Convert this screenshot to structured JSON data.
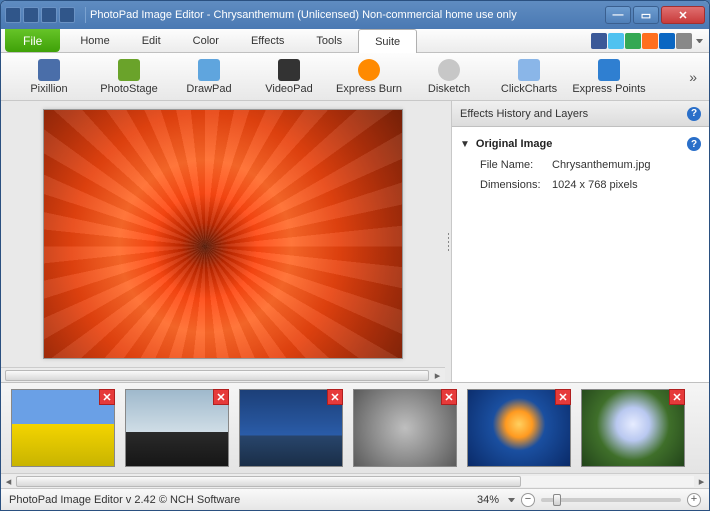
{
  "title": "PhotoPad Image Editor - Chrysanthemum (Unlicensed) Non-commercial home use only",
  "menu": {
    "file": "File",
    "items": [
      "Home",
      "Edit",
      "Color",
      "Effects",
      "Tools",
      "Suite"
    ],
    "active": "Suite"
  },
  "social_colors": [
    "#3b5998",
    "#4fc2f0",
    "#34a853",
    "#ff6f1e",
    "#0a66c2",
    "#888888"
  ],
  "toolbar": [
    {
      "label": "Pixillion",
      "color": "#4a6ea9"
    },
    {
      "label": "PhotoStage",
      "color": "#6aa32a"
    },
    {
      "label": "DrawPad",
      "color": "#5fa5de"
    },
    {
      "label": "VideoPad",
      "color": "#333333"
    },
    {
      "label": "Express Burn",
      "color": "#ff8a00"
    },
    {
      "label": "Disketch",
      "color": "#c7c7c7"
    },
    {
      "label": "ClickCharts",
      "color": "#8ab6e8"
    },
    {
      "label": "Express Points",
      "color": "#2f7fd1"
    }
  ],
  "panel": {
    "title": "Effects History and Layers",
    "original": "Original Image",
    "filename_k": "File Name:",
    "filename_v": "Chrysanthemum.jpg",
    "dim_k": "Dimensions:",
    "dim_v": "1024 x 768 pixels"
  },
  "thumbs": [
    {
      "bg": "linear-gradient(180deg,#6aa0e6 0%,#6aa0e6 45%,#f3d400 45%,#c9b400 100%)"
    },
    {
      "bg": "linear-gradient(180deg,#9fb9cc 0%,#cfdde6 55%,#2a2a2a 55%,#161616 100%)"
    },
    {
      "bg": "linear-gradient(180deg,#1c3f78 0%,#2a5ca8 60%,#28456b 60%,#1a2e48 100%)"
    },
    {
      "bg": "radial-gradient(circle at 50% 50%,#bfbfbf 0%,#8d8d8d 50%,#5a5a5a 100%)"
    },
    {
      "bg": "radial-gradient(circle at 50% 45%,#ffd060 0%,#ff9a20 20%,#1a4fa0 40%,#0a2a68 100%)"
    },
    {
      "bg": "radial-gradient(circle at 50% 45%,#e6ecff 0%,#b9c8f0 25%,#3f6f2a 55%,#22441a 100%)"
    }
  ],
  "status": {
    "text": "PhotoPad Image Editor v 2.42 © NCH Software",
    "zoom": "34%"
  }
}
